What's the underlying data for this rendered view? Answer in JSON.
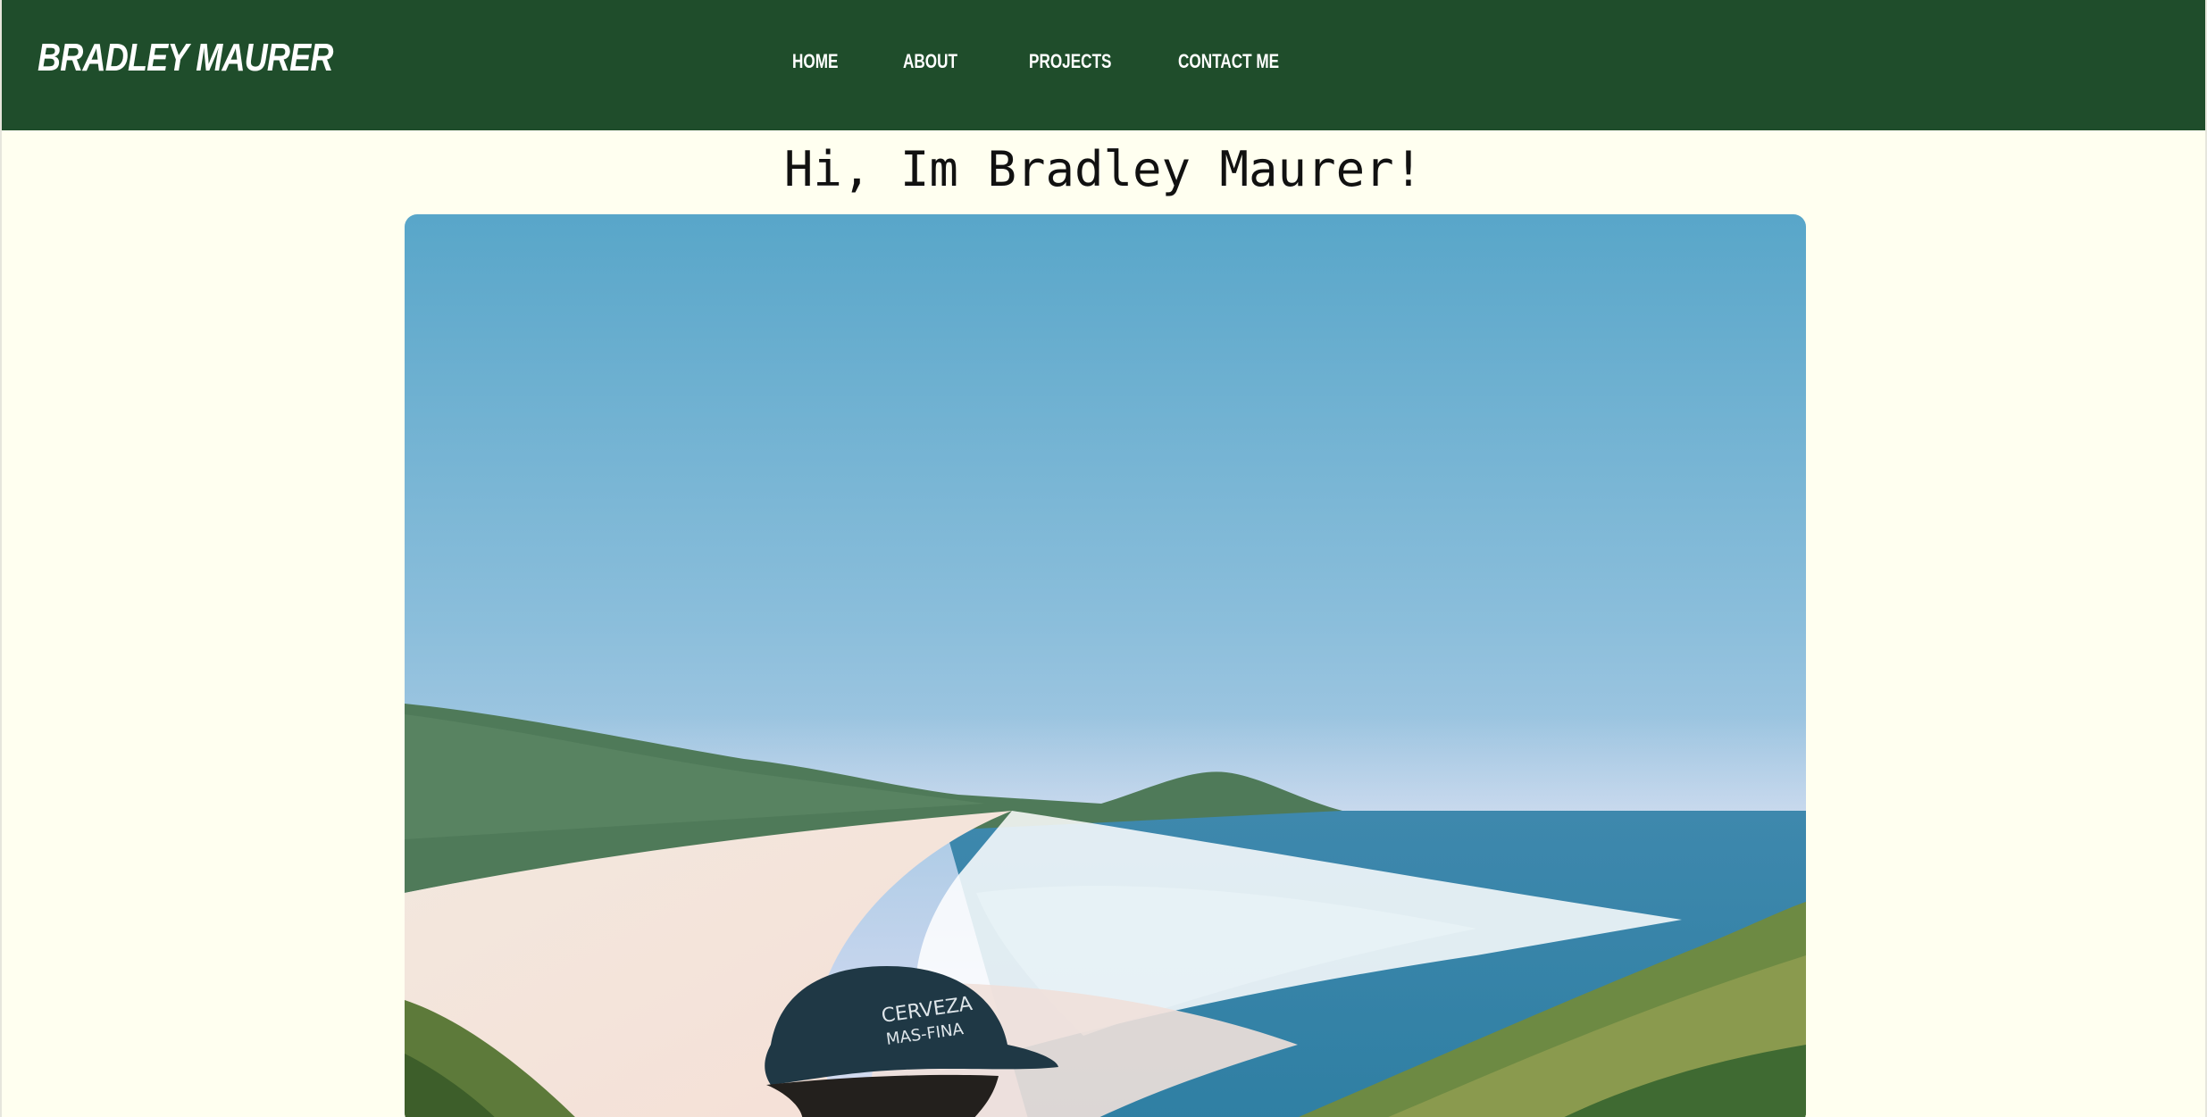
{
  "site": {
    "brand": "BRADLEY MAURER"
  },
  "nav": {
    "items": [
      {
        "label": "HOME"
      },
      {
        "label": "ABOUT"
      },
      {
        "label": "PROJECTS"
      },
      {
        "label": "CONTACT ME"
      }
    ]
  },
  "hero": {
    "title": "Hi, Im Bradley Maurer!",
    "photo_icon": "beach-portrait-photo"
  },
  "colors": {
    "navbar": "#1f4d2b",
    "background": "#fffff0",
    "nav_text": "#ffffff"
  }
}
